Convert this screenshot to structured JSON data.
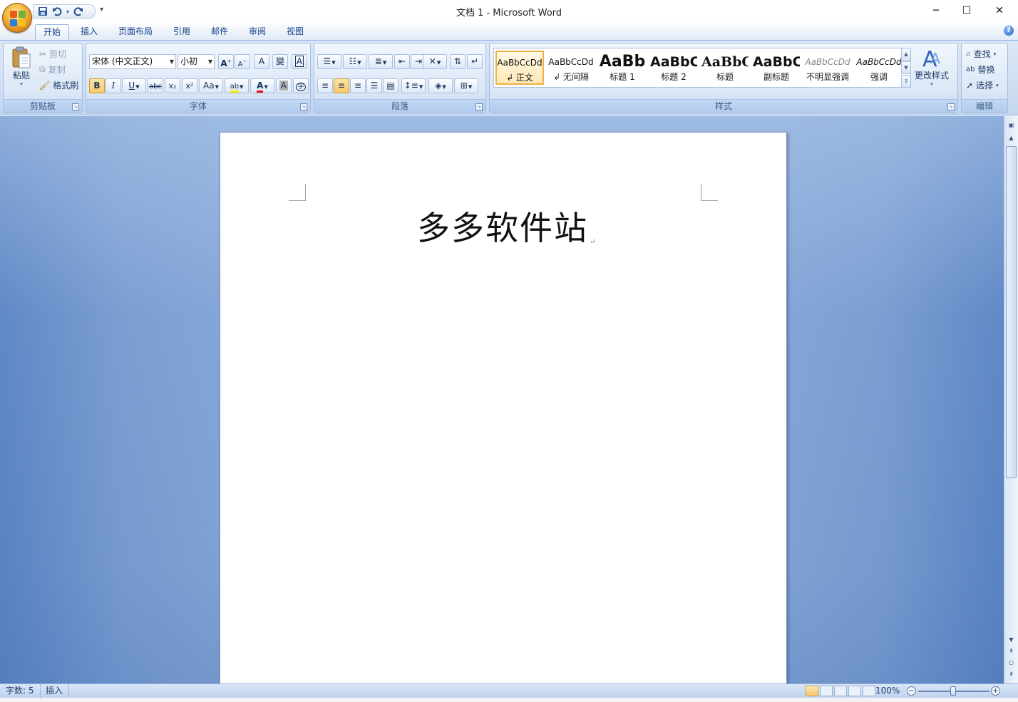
{
  "window": {
    "title": "文档 1 - Microsoft Word",
    "minimize": "─",
    "maximize": "☐",
    "close": "✕"
  },
  "qat": {
    "more": "▾"
  },
  "tabs": [
    {
      "label": "开始",
      "active": true
    },
    {
      "label": "插入"
    },
    {
      "label": "页面布局"
    },
    {
      "label": "引用"
    },
    {
      "label": "邮件"
    },
    {
      "label": "审阅"
    },
    {
      "label": "视图"
    }
  ],
  "help": "?",
  "clipboard": {
    "label": "剪贴板",
    "paste": "粘贴",
    "cut": "剪切",
    "copy": "复制",
    "format_painter": "格式刷"
  },
  "font": {
    "label": "字体",
    "name": "宋体 (中文正文)",
    "size": "小初",
    "grow": "A",
    "shrink": "A",
    "clear": "A",
    "phonetic": "變",
    "border": "A",
    "bold": "B",
    "italic": "I",
    "underline": "U",
    "strike": "abc",
    "subscript": "x₂",
    "superscript": "x²",
    "case": "Aa",
    "highlight": "ab",
    "color": "A",
    "shade": "A",
    "enclose": "字"
  },
  "paragraph": {
    "label": "段落"
  },
  "styles": {
    "label": "样式",
    "items": [
      {
        "sample": "AaBbCcDd",
        "name": "↲ 正文"
      },
      {
        "sample": "AaBbCcDd",
        "name": "↲ 无间隔"
      },
      {
        "sample": "AaBb",
        "name": "标题 1"
      },
      {
        "sample": "AaBbC",
        "name": "标题 2"
      },
      {
        "sample": "AaBbC",
        "name": "标题"
      },
      {
        "sample": "AaBbC",
        "name": "副标题"
      },
      {
        "sample": "AaBbCcDd",
        "name": "不明显强调"
      },
      {
        "sample": "AaBbCcDd",
        "name": "强调"
      }
    ],
    "change_styles": "更改样式"
  },
  "editing": {
    "label": "编辑",
    "find": "查找",
    "replace": "替换",
    "select": "选择"
  },
  "document": {
    "text": "多多软件站",
    "para_mark": "↵"
  },
  "status": {
    "word_count": "字数: 5",
    "mode": "插入",
    "zoom": "100%",
    "zoom_level": 1.0,
    "zoom_out": "−",
    "zoom_in": "+"
  },
  "colors": {
    "accent": "#15428b",
    "font_color": "#e01010",
    "highlight": "#f4f000"
  }
}
